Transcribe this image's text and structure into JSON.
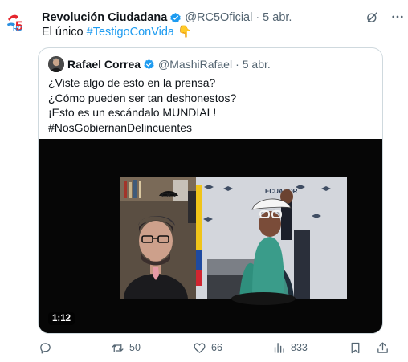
{
  "tweet": {
    "author_name": "Revolución Ciudadana",
    "handle": "@RC5Oficial",
    "date": "5 abr.",
    "text_prefix": "El único ",
    "hashtag": "#TestigoConVida",
    "emoji": "👇"
  },
  "quote": {
    "author_name": "Rafael Correa",
    "handle": "@MashiRafael",
    "date": "5 abr.",
    "lines": [
      "¿Viste algo de esto en la prensa?",
      "¿Cómo pueden ser tan deshonestos?",
      "¡Esto es un escándalo MUNDIAL!",
      "#NosGobiernanDelincuentes"
    ],
    "video": {
      "duration": "1:12",
      "backdrop_text": "ECUADOR"
    }
  },
  "actions": {
    "replies": "",
    "retweets": "50",
    "likes": "66",
    "views": "833"
  },
  "colors": {
    "accent": "#1d9bf0",
    "text": "#0f1419",
    "muted": "#536471",
    "border": "#cfd9de",
    "brand_red": "#e5262d",
    "brand_blue": "#2a8fe0"
  },
  "icons": [
    "rc5-logo",
    "verified-icon",
    "grok-icon",
    "more-icon",
    "reply-icon",
    "retweet-icon",
    "like-icon",
    "views-icon",
    "bookmark-icon",
    "share-icon",
    "rafael-avatar"
  ]
}
